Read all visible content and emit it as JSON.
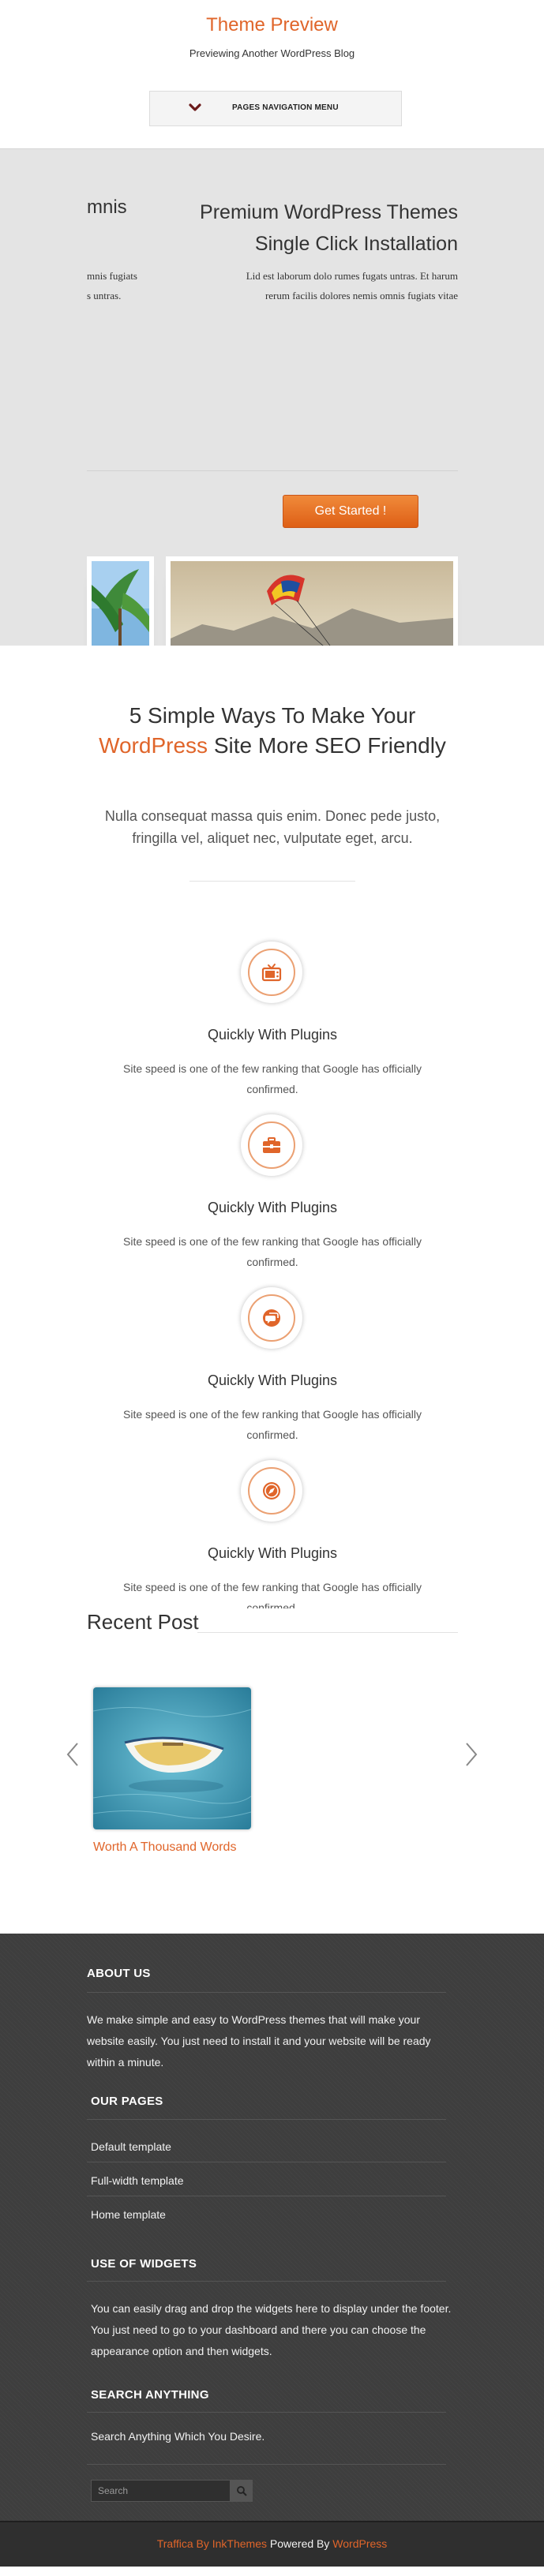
{
  "header": {
    "title": "Theme Preview",
    "tagline": "Previewing Another WordPress Blog",
    "nav_label": "PAGES NAVIGATION MENU"
  },
  "hero": {
    "prev_slide_title": "mnis",
    "prev_slide_line1": "mnis fugiats",
    "prev_slide_line2": "s untras.",
    "title_line1": "Premium WordPress Themes",
    "title_line2": "Single Click Installation",
    "desc_line1": "Lid est laborum dolo rumes fugats untras. Et harum",
    "desc_line2": "rerum facilis dolores nemis omnis fugiats vitae",
    "cta_label": "Get Started !"
  },
  "features": {
    "title_before": "5 Simple Ways To Make Your",
    "title_accent": "WordPress",
    "title_after": "Site More SEO Friendly",
    "subtitle": "Nulla consequat massa quis enim. Donec pede justo, fringilla vel, aliquet nec, vulputate eget, arcu.",
    "items": [
      {
        "icon": "tv-icon",
        "title": "Quickly With Plugins",
        "text": "Site speed is one of the few ranking that Google has officially confirmed."
      },
      {
        "icon": "briefcase-icon",
        "title": "Quickly With Plugins",
        "text": "Site speed is one of the few ranking that Google has officially confirmed."
      },
      {
        "icon": "chat-icon",
        "title": "Quickly With Plugins",
        "text": "Site speed is one of the few ranking that Google has officially confirmed."
      },
      {
        "icon": "compass-icon",
        "title": "Quickly With Plugins",
        "text": "Site speed is one of the few ranking that Google has officially confirmed."
      }
    ]
  },
  "recent": {
    "title": "Recent Post",
    "post_title": "Worth A Thousand Words"
  },
  "footer": {
    "about_heading": "ABOUT US",
    "about_text": "We make simple and easy to WordPress themes that will make your website easily. You just need to install it and your website will be ready within a minute.",
    "pages_heading": "OUR PAGES",
    "pages": [
      "Default template",
      "Full-width template",
      "Home template"
    ],
    "widgets_heading": "USE OF WIDGETS",
    "widgets_text": "You can easily drag and drop the widgets here to display under the footer. You just need to go to your dashboard and there you can choose the appearance option and then widgets.",
    "search_heading": "SEARCH ANYTHING",
    "search_text": "Search Anything Which You Desire.",
    "search_placeholder": "Search",
    "credit_brand": "Traffica By InkThemes",
    "credit_middle": "Powered By",
    "credit_platform": "WordPress"
  },
  "colors": {
    "accent": "#e0652a",
    "hero_bg": "#e4e4e4",
    "footer_bg": "#3e3e3e"
  }
}
